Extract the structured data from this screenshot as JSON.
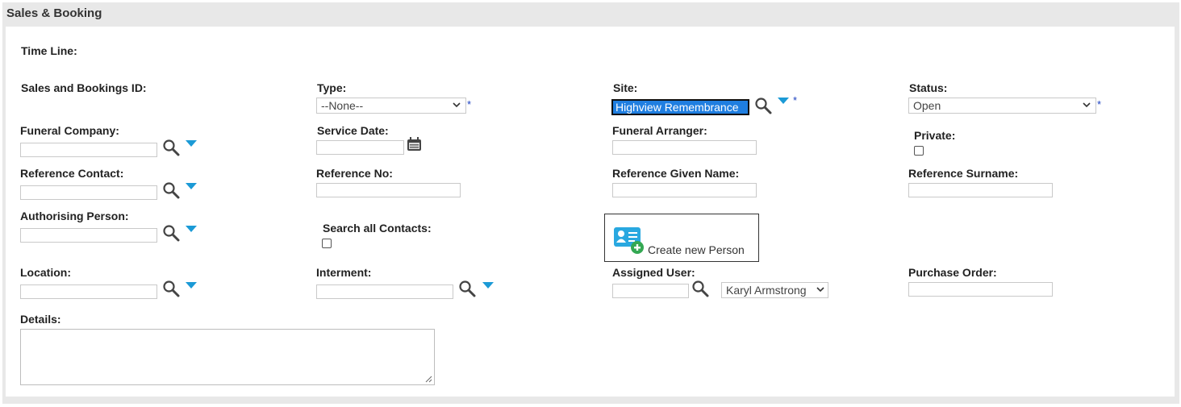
{
  "panel": {
    "title": "Sales & Booking"
  },
  "labels": {
    "time_line": "Time Line:",
    "sales_id": "Sales and Bookings ID:",
    "type": "Type:",
    "site": "Site:",
    "status": "Status:",
    "funeral_company": "Funeral Company:",
    "service_date": "Service Date:",
    "funeral_arranger": "Funeral Arranger:",
    "private": "Private:",
    "reference_contact": "Reference Contact:",
    "reference_no": "Reference No:",
    "reference_given_name": "Reference Given Name:",
    "reference_surname": "Reference Surname:",
    "authorising_person": "Authorising Person:",
    "search_all_contacts": "Search all Contacts:",
    "location": "Location:",
    "interment": "Interment:",
    "assigned_user": "Assigned User:",
    "purchase_order": "Purchase Order:",
    "details": "Details:"
  },
  "fields": {
    "type_value": "--None--",
    "site_value": "Highview Remembrance",
    "status_value": "Open",
    "assigned_user_value": "Karyl Armstrong",
    "required_marker": "*"
  },
  "create_person": {
    "label": "Create new Person"
  },
  "colors": {
    "accent": "#1b9ad6",
    "required": "#1a3fbf",
    "selection": "#1f7ee0",
    "panel_bg": "#e8e8e8"
  }
}
